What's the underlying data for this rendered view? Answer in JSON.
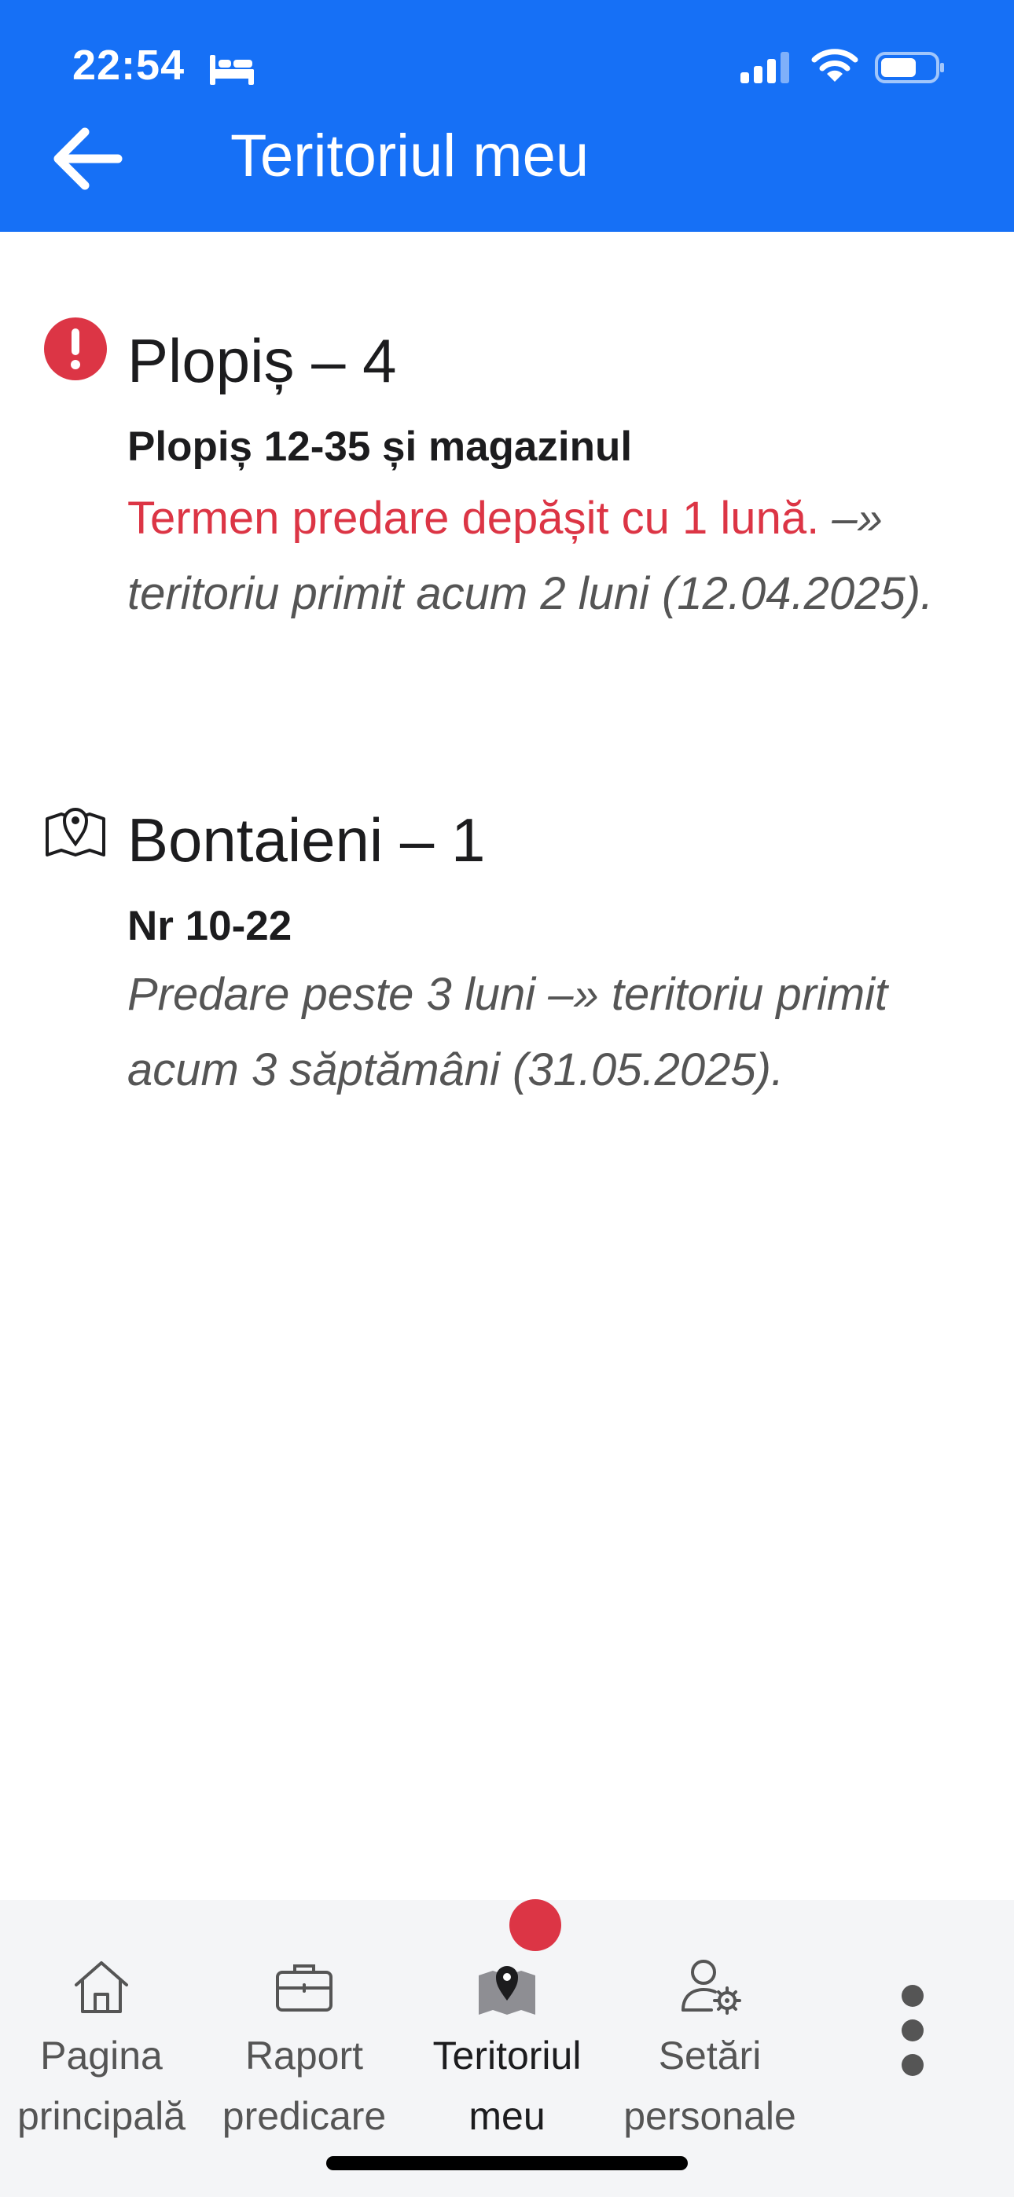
{
  "status_bar": {
    "time": "22:54"
  },
  "header": {
    "title": "Teritoriul meu",
    "bg_color": "#1670f6"
  },
  "territories": [
    {
      "icon": "exclamation-circle-icon",
      "title": "Plopiș – 4",
      "subtitle": "Plopiș 12-35 și magazinul",
      "warning": "Termen predare depășit cu 1 lună.",
      "detail": " –» teritoriu primit acum 2 luni (12.04.2025)."
    },
    {
      "icon": "map-pin-icon",
      "title": "Bontaieni – 1",
      "subtitle": "Nr 10-22",
      "detail": "Predare peste 3 luni –» teritoriu primit acum 3 săptămâni (31.05.2025)."
    }
  ],
  "tabs": [
    {
      "icon": "home-icon",
      "label": "Pagina\nprincipală",
      "active": false
    },
    {
      "icon": "briefcase-icon",
      "label": "Raport\npredicare",
      "active": false
    },
    {
      "icon": "map-pin-icon",
      "label": "Teritoriul\nmeu",
      "active": true
    },
    {
      "icon": "user-settings-icon",
      "label": "Setări\npersonale",
      "active": false
    },
    {
      "icon": "more-vertical-icon",
      "label": "",
      "active": false
    }
  ],
  "colors": {
    "warning": "#dc3545",
    "accent": "#1670f6"
  }
}
